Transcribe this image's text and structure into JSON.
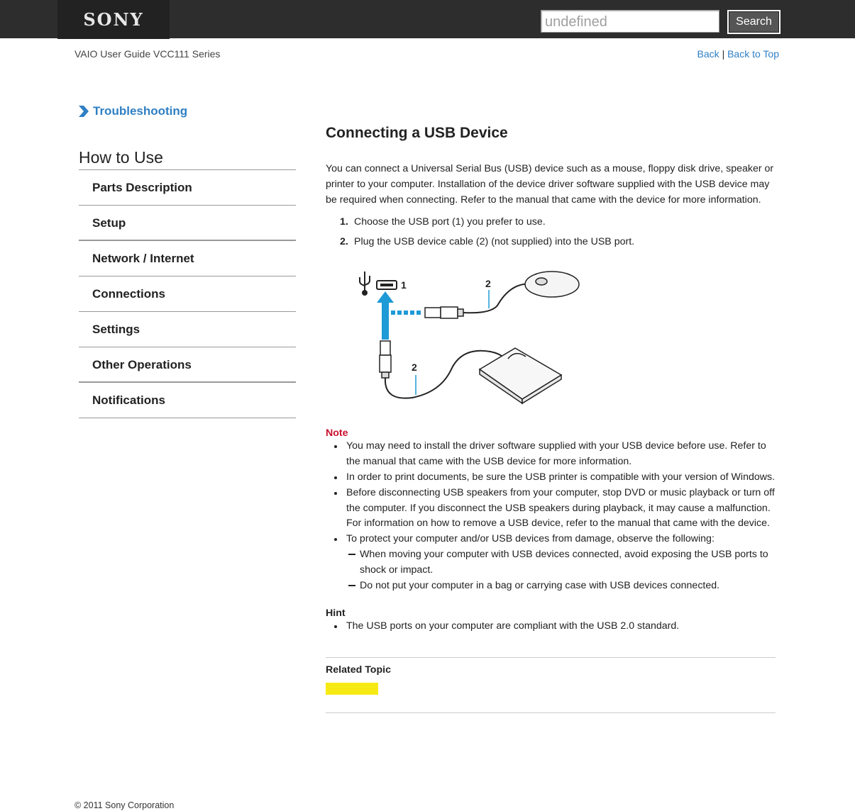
{
  "header": {
    "logo": "SONY",
    "search": {
      "value": "undefined",
      "placeholder": "undefined",
      "button_label": "Search"
    },
    "guide_title": "VAIO User Guide VCC111 Series",
    "nav": {
      "back": "Back",
      "separator": "|",
      "back_to_top": "Back to Top"
    }
  },
  "sidebar": {
    "troubleshooting": "Troubleshooting",
    "section_title": "How to Use",
    "items": [
      {
        "label": "Parts Description"
      },
      {
        "label": "Setup"
      },
      {
        "label": "Network / Internet"
      },
      {
        "label": "Connections"
      },
      {
        "label": "Settings"
      },
      {
        "label": "Other Operations"
      },
      {
        "label": "Notifications"
      }
    ]
  },
  "main": {
    "title": "Connecting a USB Device",
    "intro": "You can connect a Universal Serial Bus (USB) device such as a mouse, floppy disk drive, speaker or printer to your computer. Installation of the device driver software supplied with the USB device may be required when connecting. Refer to the manual that came with the device for more information.",
    "steps": [
      {
        "num": "1.",
        "text": "Choose the USB port (1) you prefer to use."
      },
      {
        "num": "2.",
        "text": "Plug the USB device cable (2) (not supplied) into the USB port."
      }
    ],
    "figure": {
      "label_port": "1",
      "label_cable_top": "2",
      "label_cable_bottom": "2"
    },
    "note": {
      "title": "Note",
      "items": [
        {
          "text": "You may need to install the driver software supplied with your USB device before use. Refer to the manual that came with the USB device for more information."
        },
        {
          "text": "In order to print documents, be sure the USB printer is compatible with your version of Windows."
        },
        {
          "text": "Before disconnecting USB speakers from your computer, stop DVD or music playback or turn off the computer. If you disconnect the USB speakers during playback, it may cause a malfunction.",
          "extra": "For information on how to remove a USB device, refer to the manual that came with the device."
        },
        {
          "text": "To protect your computer and/or USB devices from damage, observe the following:",
          "sub": [
            "When moving your computer with USB devices connected, avoid exposing the USB ports to shock or impact.",
            "Do not put your computer in a bag or carrying case with USB devices connected."
          ]
        }
      ]
    },
    "hint": {
      "title": "Hint",
      "items": [
        {
          "text": "The USB ports on your computer are compliant with the USB 2.0 standard."
        }
      ]
    },
    "related": {
      "title": "Related Topic",
      "highlight_color": "#f7ea14"
    }
  },
  "footer": {
    "copyright": "© 2011 Sony Corporation"
  },
  "colors": {
    "topbar": "#2e2d2d",
    "link": "#2f7fc3",
    "note": "#c8102e",
    "usb_arrow": "#1e9ad6"
  }
}
